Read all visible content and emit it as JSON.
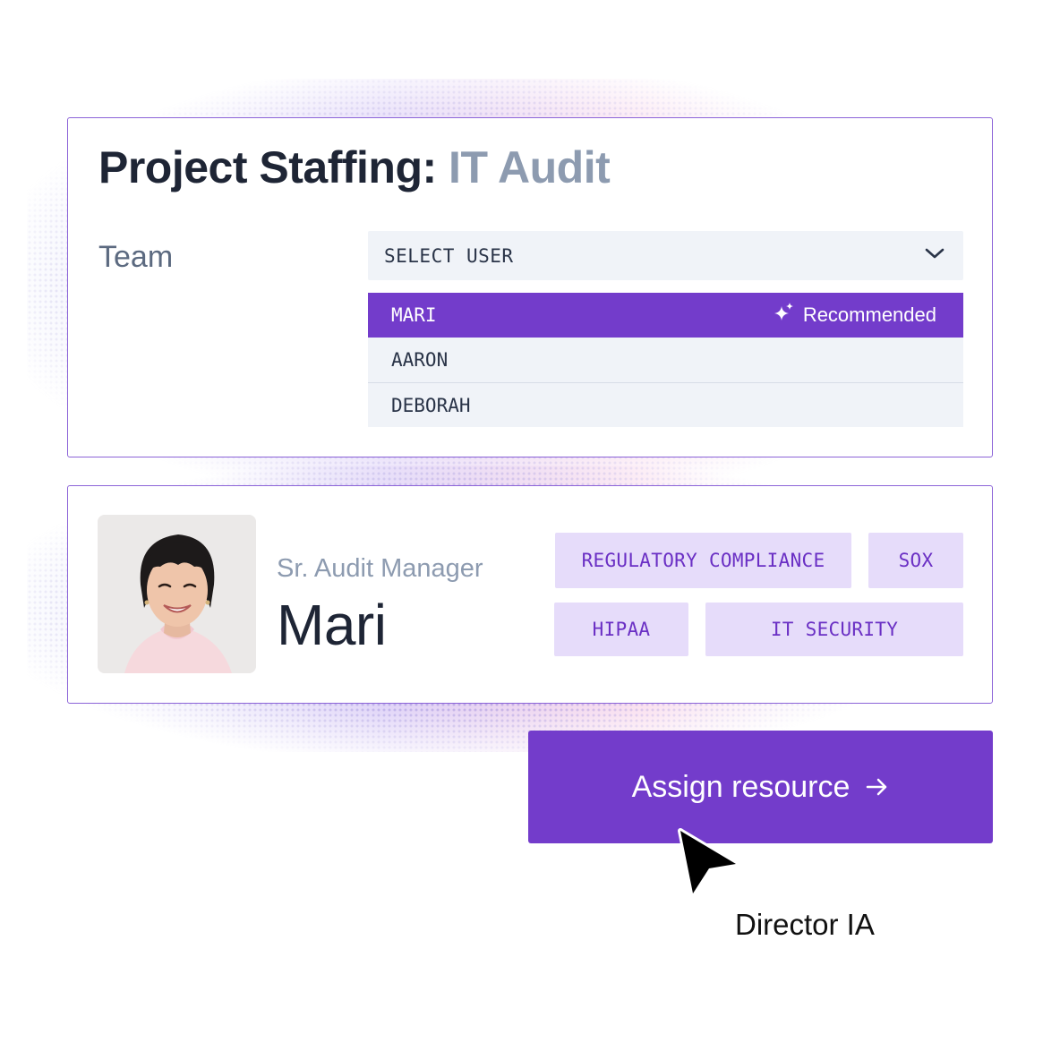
{
  "staffing": {
    "title_main": "Project Staffing:",
    "title_sub": "IT Audit",
    "team_label": "Team",
    "select": {
      "placeholder": "SELECT USER",
      "options": [
        {
          "label": "MARI",
          "selected": true,
          "badge": "Recommended"
        },
        {
          "label": "AARON",
          "selected": false
        },
        {
          "label": "DEBORAH",
          "selected": false
        }
      ]
    }
  },
  "profile": {
    "role": "Sr. Audit Manager",
    "name": "Mari",
    "tags": [
      "REGULATORY COMPLIANCE",
      "SOX",
      "HIPAA",
      "IT SECURITY"
    ]
  },
  "assign_button": {
    "label": "Assign resource"
  },
  "cursor": {
    "caption": "Director IA"
  },
  "colors": {
    "accent": "#733ccb",
    "tag_bg": "#e6dcfa",
    "tag_text": "#6a2fc4",
    "card_border": "#8c64d8",
    "muted_text": "#8d9bb0"
  },
  "icons": [
    "chevron-down-icon",
    "sparkle-icon",
    "arrow-right-icon",
    "cursor-icon"
  ]
}
